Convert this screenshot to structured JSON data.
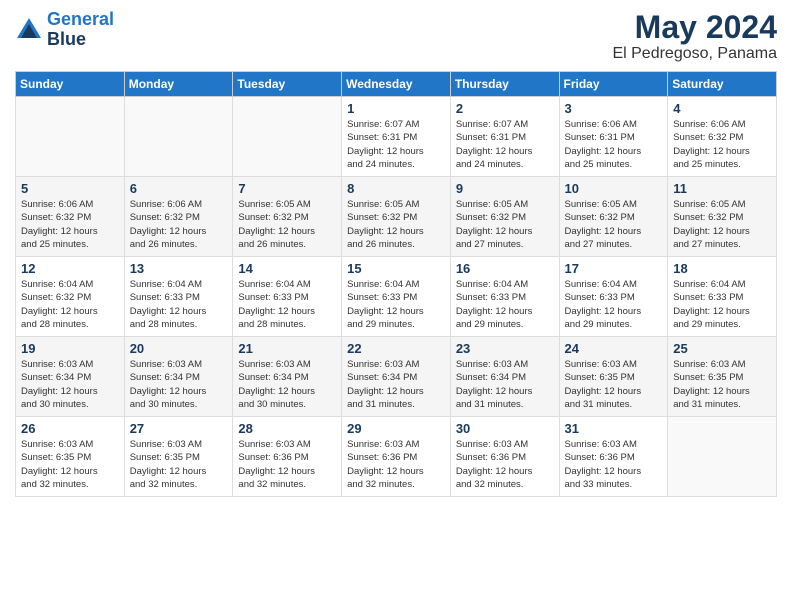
{
  "logo": {
    "line1": "General",
    "line2": "Blue"
  },
  "title": "May 2024",
  "location": "El Pedregoso, Panama",
  "weekdays": [
    "Sunday",
    "Monday",
    "Tuesday",
    "Wednesday",
    "Thursday",
    "Friday",
    "Saturday"
  ],
  "weeks": [
    [
      {
        "day": "",
        "info": ""
      },
      {
        "day": "",
        "info": ""
      },
      {
        "day": "",
        "info": ""
      },
      {
        "day": "1",
        "info": "Sunrise: 6:07 AM\nSunset: 6:31 PM\nDaylight: 12 hours\nand 24 minutes."
      },
      {
        "day": "2",
        "info": "Sunrise: 6:07 AM\nSunset: 6:31 PM\nDaylight: 12 hours\nand 24 minutes."
      },
      {
        "day": "3",
        "info": "Sunrise: 6:06 AM\nSunset: 6:31 PM\nDaylight: 12 hours\nand 25 minutes."
      },
      {
        "day": "4",
        "info": "Sunrise: 6:06 AM\nSunset: 6:32 PM\nDaylight: 12 hours\nand 25 minutes."
      }
    ],
    [
      {
        "day": "5",
        "info": "Sunrise: 6:06 AM\nSunset: 6:32 PM\nDaylight: 12 hours\nand 25 minutes."
      },
      {
        "day": "6",
        "info": "Sunrise: 6:06 AM\nSunset: 6:32 PM\nDaylight: 12 hours\nand 26 minutes."
      },
      {
        "day": "7",
        "info": "Sunrise: 6:05 AM\nSunset: 6:32 PM\nDaylight: 12 hours\nand 26 minutes."
      },
      {
        "day": "8",
        "info": "Sunrise: 6:05 AM\nSunset: 6:32 PM\nDaylight: 12 hours\nand 26 minutes."
      },
      {
        "day": "9",
        "info": "Sunrise: 6:05 AM\nSunset: 6:32 PM\nDaylight: 12 hours\nand 27 minutes."
      },
      {
        "day": "10",
        "info": "Sunrise: 6:05 AM\nSunset: 6:32 PM\nDaylight: 12 hours\nand 27 minutes."
      },
      {
        "day": "11",
        "info": "Sunrise: 6:05 AM\nSunset: 6:32 PM\nDaylight: 12 hours\nand 27 minutes."
      }
    ],
    [
      {
        "day": "12",
        "info": "Sunrise: 6:04 AM\nSunset: 6:32 PM\nDaylight: 12 hours\nand 28 minutes."
      },
      {
        "day": "13",
        "info": "Sunrise: 6:04 AM\nSunset: 6:33 PM\nDaylight: 12 hours\nand 28 minutes."
      },
      {
        "day": "14",
        "info": "Sunrise: 6:04 AM\nSunset: 6:33 PM\nDaylight: 12 hours\nand 28 minutes."
      },
      {
        "day": "15",
        "info": "Sunrise: 6:04 AM\nSunset: 6:33 PM\nDaylight: 12 hours\nand 29 minutes."
      },
      {
        "day": "16",
        "info": "Sunrise: 6:04 AM\nSunset: 6:33 PM\nDaylight: 12 hours\nand 29 minutes."
      },
      {
        "day": "17",
        "info": "Sunrise: 6:04 AM\nSunset: 6:33 PM\nDaylight: 12 hours\nand 29 minutes."
      },
      {
        "day": "18",
        "info": "Sunrise: 6:04 AM\nSunset: 6:33 PM\nDaylight: 12 hours\nand 29 minutes."
      }
    ],
    [
      {
        "day": "19",
        "info": "Sunrise: 6:03 AM\nSunset: 6:34 PM\nDaylight: 12 hours\nand 30 minutes."
      },
      {
        "day": "20",
        "info": "Sunrise: 6:03 AM\nSunset: 6:34 PM\nDaylight: 12 hours\nand 30 minutes."
      },
      {
        "day": "21",
        "info": "Sunrise: 6:03 AM\nSunset: 6:34 PM\nDaylight: 12 hours\nand 30 minutes."
      },
      {
        "day": "22",
        "info": "Sunrise: 6:03 AM\nSunset: 6:34 PM\nDaylight: 12 hours\nand 31 minutes."
      },
      {
        "day": "23",
        "info": "Sunrise: 6:03 AM\nSunset: 6:34 PM\nDaylight: 12 hours\nand 31 minutes."
      },
      {
        "day": "24",
        "info": "Sunrise: 6:03 AM\nSunset: 6:35 PM\nDaylight: 12 hours\nand 31 minutes."
      },
      {
        "day": "25",
        "info": "Sunrise: 6:03 AM\nSunset: 6:35 PM\nDaylight: 12 hours\nand 31 minutes."
      }
    ],
    [
      {
        "day": "26",
        "info": "Sunrise: 6:03 AM\nSunset: 6:35 PM\nDaylight: 12 hours\nand 32 minutes."
      },
      {
        "day": "27",
        "info": "Sunrise: 6:03 AM\nSunset: 6:35 PM\nDaylight: 12 hours\nand 32 minutes."
      },
      {
        "day": "28",
        "info": "Sunrise: 6:03 AM\nSunset: 6:36 PM\nDaylight: 12 hours\nand 32 minutes."
      },
      {
        "day": "29",
        "info": "Sunrise: 6:03 AM\nSunset: 6:36 PM\nDaylight: 12 hours\nand 32 minutes."
      },
      {
        "day": "30",
        "info": "Sunrise: 6:03 AM\nSunset: 6:36 PM\nDaylight: 12 hours\nand 32 minutes."
      },
      {
        "day": "31",
        "info": "Sunrise: 6:03 AM\nSunset: 6:36 PM\nDaylight: 12 hours\nand 33 minutes."
      },
      {
        "day": "",
        "info": ""
      }
    ]
  ]
}
